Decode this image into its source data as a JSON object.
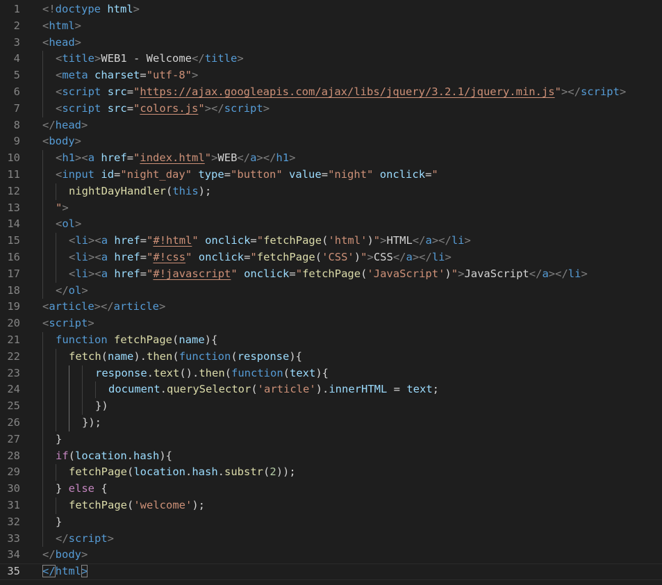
{
  "editor": {
    "language": "html",
    "current_line": 35,
    "colors": {
      "background": "#1e1e1e",
      "tag": "#569cd6",
      "attribute": "#9cdcfe",
      "string": "#ce9178",
      "text": "#d4d4d4",
      "control": "#c586c0",
      "function": "#dcdcaa",
      "number": "#b5cea8",
      "line_number": "#858585"
    },
    "lines": [
      {
        "n": "1",
        "indent": 0,
        "tokens": [
          [
            "p",
            "<!"
          ],
          [
            "t",
            "doctype"
          ],
          [
            "x",
            " "
          ],
          [
            "a",
            "html"
          ],
          [
            "p",
            ">"
          ]
        ]
      },
      {
        "n": "2",
        "indent": 0,
        "tokens": [
          [
            "p",
            "<"
          ],
          [
            "t",
            "html"
          ],
          [
            "p",
            ">"
          ]
        ]
      },
      {
        "n": "3",
        "indent": 0,
        "tokens": [
          [
            "p",
            "<"
          ],
          [
            "t",
            "head"
          ],
          [
            "p",
            ">"
          ]
        ]
      },
      {
        "n": "4",
        "indent": 1,
        "tokens": [
          [
            "p",
            "<"
          ],
          [
            "t",
            "title"
          ],
          [
            "p",
            ">"
          ],
          [
            "x",
            "WEB1 - Welcome"
          ],
          [
            "p",
            "</"
          ],
          [
            "t",
            "title"
          ],
          [
            "p",
            ">"
          ]
        ]
      },
      {
        "n": "5",
        "indent": 1,
        "tokens": [
          [
            "p",
            "<"
          ],
          [
            "t",
            "meta"
          ],
          [
            "x",
            " "
          ],
          [
            "a",
            "charset"
          ],
          [
            "x",
            "="
          ],
          [
            "s",
            "\"utf-8\""
          ],
          [
            "p",
            ">"
          ]
        ]
      },
      {
        "n": "6",
        "indent": 1,
        "tokens": [
          [
            "p",
            "<"
          ],
          [
            "t",
            "script"
          ],
          [
            "x",
            " "
          ],
          [
            "a",
            "src"
          ],
          [
            "x",
            "="
          ],
          [
            "s",
            "\""
          ],
          [
            "u",
            "https://ajax.googleapis.com/ajax/libs/jquery/3.2.1/jquery.min.js"
          ],
          [
            "s",
            "\""
          ],
          [
            "p",
            "></"
          ],
          [
            "t",
            "script"
          ],
          [
            "p",
            ">"
          ]
        ]
      },
      {
        "n": "7",
        "indent": 1,
        "tokens": [
          [
            "p",
            "<"
          ],
          [
            "t",
            "script"
          ],
          [
            "x",
            " "
          ],
          [
            "a",
            "src"
          ],
          [
            "x",
            "="
          ],
          [
            "s",
            "\""
          ],
          [
            "u",
            "colors.js"
          ],
          [
            "s",
            "\""
          ],
          [
            "p",
            "></"
          ],
          [
            "t",
            "script"
          ],
          [
            "p",
            ">"
          ]
        ]
      },
      {
        "n": "8",
        "indent": 0,
        "tokens": [
          [
            "p",
            "</"
          ],
          [
            "t",
            "head"
          ],
          [
            "p",
            ">"
          ]
        ]
      },
      {
        "n": "9",
        "indent": 0,
        "tokens": [
          [
            "p",
            "<"
          ],
          [
            "t",
            "body"
          ],
          [
            "p",
            ">"
          ]
        ]
      },
      {
        "n": "10",
        "indent": 1,
        "tokens": [
          [
            "p",
            "<"
          ],
          [
            "t",
            "h1"
          ],
          [
            "p",
            "><"
          ],
          [
            "t",
            "a"
          ],
          [
            "x",
            " "
          ],
          [
            "a",
            "href"
          ],
          [
            "x",
            "="
          ],
          [
            "s",
            "\""
          ],
          [
            "u",
            "index.html"
          ],
          [
            "s",
            "\""
          ],
          [
            "p",
            ">"
          ],
          [
            "x",
            "WEB"
          ],
          [
            "p",
            "</"
          ],
          [
            "t",
            "a"
          ],
          [
            "p",
            "></"
          ],
          [
            "t",
            "h1"
          ],
          [
            "p",
            ">"
          ]
        ]
      },
      {
        "n": "11",
        "indent": 1,
        "tokens": [
          [
            "p",
            "<"
          ],
          [
            "t",
            "input"
          ],
          [
            "x",
            " "
          ],
          [
            "a",
            "id"
          ],
          [
            "x",
            "="
          ],
          [
            "s",
            "\"night_day\""
          ],
          [
            "x",
            " "
          ],
          [
            "a",
            "type"
          ],
          [
            "x",
            "="
          ],
          [
            "s",
            "\"button\""
          ],
          [
            "x",
            " "
          ],
          [
            "a",
            "value"
          ],
          [
            "x",
            "="
          ],
          [
            "s",
            "\"night\""
          ],
          [
            "x",
            " "
          ],
          [
            "a",
            "onclick"
          ],
          [
            "x",
            "="
          ],
          [
            "s",
            "\""
          ]
        ]
      },
      {
        "n": "12",
        "indent": 2,
        "tokens": [
          [
            "f",
            "nightDayHandler"
          ],
          [
            "x",
            "("
          ],
          [
            "k",
            "this"
          ],
          [
            "x",
            ");"
          ]
        ]
      },
      {
        "n": "13",
        "indent": 1,
        "tokens": [
          [
            "s",
            "\""
          ],
          [
            "p",
            ">"
          ]
        ]
      },
      {
        "n": "14",
        "indent": 1,
        "tokens": [
          [
            "p",
            "<"
          ],
          [
            "t",
            "ol"
          ],
          [
            "p",
            ">"
          ]
        ]
      },
      {
        "n": "15",
        "indent": 2,
        "tokens": [
          [
            "p",
            "<"
          ],
          [
            "t",
            "li"
          ],
          [
            "p",
            "><"
          ],
          [
            "t",
            "a"
          ],
          [
            "x",
            " "
          ],
          [
            "a",
            "href"
          ],
          [
            "x",
            "="
          ],
          [
            "s",
            "\""
          ],
          [
            "u",
            "#!html"
          ],
          [
            "s",
            "\""
          ],
          [
            "x",
            " "
          ],
          [
            "a",
            "onclick"
          ],
          [
            "x",
            "="
          ],
          [
            "s",
            "\""
          ],
          [
            "f",
            "fetchPage"
          ],
          [
            "x",
            "("
          ],
          [
            "s",
            "'html'"
          ],
          [
            "x",
            ")"
          ],
          [
            "s",
            "\""
          ],
          [
            "p",
            ">"
          ],
          [
            "x",
            "HTML"
          ],
          [
            "p",
            "</"
          ],
          [
            "t",
            "a"
          ],
          [
            "p",
            "></"
          ],
          [
            "t",
            "li"
          ],
          [
            "p",
            ">"
          ]
        ]
      },
      {
        "n": "16",
        "indent": 2,
        "tokens": [
          [
            "p",
            "<"
          ],
          [
            "t",
            "li"
          ],
          [
            "p",
            "><"
          ],
          [
            "t",
            "a"
          ],
          [
            "x",
            " "
          ],
          [
            "a",
            "href"
          ],
          [
            "x",
            "="
          ],
          [
            "s",
            "\""
          ],
          [
            "u",
            "#!css"
          ],
          [
            "s",
            "\""
          ],
          [
            "x",
            " "
          ],
          [
            "a",
            "onclick"
          ],
          [
            "x",
            "="
          ],
          [
            "s",
            "\""
          ],
          [
            "f",
            "fetchPage"
          ],
          [
            "x",
            "("
          ],
          [
            "s",
            "'CSS'"
          ],
          [
            "x",
            ")"
          ],
          [
            "s",
            "\""
          ],
          [
            "p",
            ">"
          ],
          [
            "x",
            "CSS"
          ],
          [
            "p",
            "</"
          ],
          [
            "t",
            "a"
          ],
          [
            "p",
            "></"
          ],
          [
            "t",
            "li"
          ],
          [
            "p",
            ">"
          ]
        ]
      },
      {
        "n": "17",
        "indent": 2,
        "tokens": [
          [
            "p",
            "<"
          ],
          [
            "t",
            "li"
          ],
          [
            "p",
            "><"
          ],
          [
            "t",
            "a"
          ],
          [
            "x",
            " "
          ],
          [
            "a",
            "href"
          ],
          [
            "x",
            "="
          ],
          [
            "s",
            "\""
          ],
          [
            "u",
            "#!javascript"
          ],
          [
            "s",
            "\""
          ],
          [
            "x",
            " "
          ],
          [
            "a",
            "onclick"
          ],
          [
            "x",
            "="
          ],
          [
            "s",
            "\""
          ],
          [
            "f",
            "fetchPage"
          ],
          [
            "x",
            "("
          ],
          [
            "s",
            "'JavaScript'"
          ],
          [
            "x",
            ")"
          ],
          [
            "s",
            "\""
          ],
          [
            "p",
            ">"
          ],
          [
            "x",
            "JavaScript"
          ],
          [
            "p",
            "</"
          ],
          [
            "t",
            "a"
          ],
          [
            "p",
            "></"
          ],
          [
            "t",
            "li"
          ],
          [
            "p",
            ">"
          ]
        ]
      },
      {
        "n": "18",
        "indent": 1,
        "tokens": [
          [
            "p",
            "</"
          ],
          [
            "t",
            "ol"
          ],
          [
            "p",
            ">"
          ]
        ]
      },
      {
        "n": "19",
        "indent": 0,
        "tokens": [
          [
            "p",
            "<"
          ],
          [
            "t",
            "article"
          ],
          [
            "p",
            "></"
          ],
          [
            "t",
            "article"
          ],
          [
            "p",
            ">"
          ]
        ]
      },
      {
        "n": "20",
        "indent": 0,
        "tokens": [
          [
            "p",
            "<"
          ],
          [
            "t",
            "script"
          ],
          [
            "p",
            ">"
          ]
        ]
      },
      {
        "n": "21",
        "indent": 1,
        "tokens": [
          [
            "k",
            "function"
          ],
          [
            "x",
            " "
          ],
          [
            "f",
            "fetchPage"
          ],
          [
            "x",
            "("
          ],
          [
            "a",
            "name"
          ],
          [
            "x",
            "){"
          ]
        ]
      },
      {
        "n": "22",
        "indent": 2,
        "tokens": [
          [
            "f",
            "fetch"
          ],
          [
            "x",
            "("
          ],
          [
            "a",
            "name"
          ],
          [
            "x",
            ")."
          ],
          [
            "f",
            "then"
          ],
          [
            "x",
            "("
          ],
          [
            "k",
            "function"
          ],
          [
            "x",
            "("
          ],
          [
            "a",
            "response"
          ],
          [
            "x",
            "){"
          ]
        ]
      },
      {
        "n": "23",
        "indent": 4,
        "tokens": [
          [
            "a",
            "response"
          ],
          [
            "x",
            "."
          ],
          [
            "f",
            "text"
          ],
          [
            "x",
            "()."
          ],
          [
            "f",
            "then"
          ],
          [
            "x",
            "("
          ],
          [
            "k",
            "function"
          ],
          [
            "x",
            "("
          ],
          [
            "a",
            "text"
          ],
          [
            "x",
            "){"
          ]
        ]
      },
      {
        "n": "24",
        "indent": 5,
        "tokens": [
          [
            "a",
            "document"
          ],
          [
            "x",
            "."
          ],
          [
            "f",
            "querySelector"
          ],
          [
            "x",
            "("
          ],
          [
            "s",
            "'article'"
          ],
          [
            "x",
            ")."
          ],
          [
            "a",
            "innerHTML"
          ],
          [
            "x",
            " = "
          ],
          [
            "a",
            "text"
          ],
          [
            "x",
            ";"
          ]
        ]
      },
      {
        "n": "25",
        "indent": 4,
        "tokens": [
          [
            "x",
            "})"
          ]
        ]
      },
      {
        "n": "26",
        "indent": 3,
        "tokens": [
          [
            "x",
            "});"
          ]
        ]
      },
      {
        "n": "27",
        "indent": 1,
        "tokens": [
          [
            "x",
            "}"
          ]
        ]
      },
      {
        "n": "28",
        "indent": 1,
        "tokens": [
          [
            "c",
            "if"
          ],
          [
            "x",
            "("
          ],
          [
            "a",
            "location"
          ],
          [
            "x",
            "."
          ],
          [
            "a",
            "hash"
          ],
          [
            "x",
            "){"
          ]
        ]
      },
      {
        "n": "29",
        "indent": 2,
        "tokens": [
          [
            "f",
            "fetchPage"
          ],
          [
            "x",
            "("
          ],
          [
            "a",
            "location"
          ],
          [
            "x",
            "."
          ],
          [
            "a",
            "hash"
          ],
          [
            "x",
            "."
          ],
          [
            "f",
            "substr"
          ],
          [
            "x",
            "("
          ],
          [
            "n",
            "2"
          ],
          [
            "x",
            "));"
          ]
        ]
      },
      {
        "n": "30",
        "indent": 1,
        "tokens": [
          [
            "x",
            "} "
          ],
          [
            "c",
            "else"
          ],
          [
            "x",
            " {"
          ]
        ]
      },
      {
        "n": "31",
        "indent": 2,
        "tokens": [
          [
            "f",
            "fetchPage"
          ],
          [
            "x",
            "("
          ],
          [
            "s",
            "'welcome'"
          ],
          [
            "x",
            ");"
          ]
        ]
      },
      {
        "n": "32",
        "indent": 1,
        "tokens": [
          [
            "x",
            "}"
          ]
        ]
      },
      {
        "n": "33",
        "indent": 1,
        "tokens": [
          [
            "p",
            "</"
          ],
          [
            "t",
            "script"
          ],
          [
            "p",
            ">"
          ]
        ]
      },
      {
        "n": "34",
        "indent": 0,
        "tokens": [
          [
            "p",
            "</"
          ],
          [
            "t",
            "body"
          ],
          [
            "p",
            ">"
          ]
        ]
      },
      {
        "n": "35",
        "indent": 0,
        "tokens": [
          [
            "b",
            "</"
          ],
          [
            "t",
            "html"
          ],
          [
            "b",
            ">"
          ]
        ]
      }
    ]
  }
}
